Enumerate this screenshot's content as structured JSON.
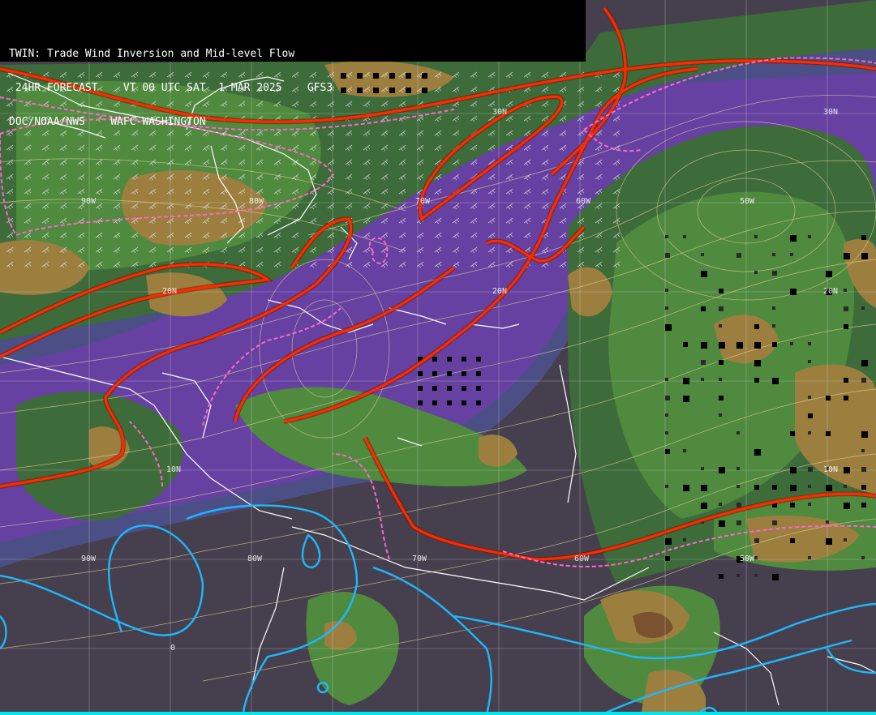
{
  "header": {
    "line1": "TWIN: Trade Wind Inversion and Mid-level Flow",
    "line2": " 24HR FORECAST    VT 00 UTC SAT  1 MAR 2025    GFS3",
    "line3": "DOC/NOAA/NWS    WAFC-WASHINGTON"
  },
  "grid_labels": {
    "lat": [
      "30N",
      "20N",
      "10N",
      "30N",
      "20N",
      "10N",
      "20N"
    ],
    "lon": [
      "90W",
      "80W",
      "70W",
      "60W",
      "50W",
      "90W",
      "80W",
      "70W",
      "60W",
      "50W",
      "0"
    ]
  },
  "colors": {
    "background": "#463f4e",
    "blue_band": "#4b4f86",
    "purple_band": "#6b3ea6",
    "green_low": "#3d6b3a",
    "green_mid": "#4f8a3e",
    "tan": "#9c7f3f",
    "brown": "#7a5230",
    "inversion_red": "#ff2a00",
    "inversion_pink": "#ff66cc",
    "cyan_contour": "#1eb8ff",
    "streamline": "#e8d79a",
    "grid": "#cfcfcf",
    "coastline": "#ffffff"
  },
  "icons": [
    "coastline-outline",
    "wind-barb",
    "streamline",
    "convection-box"
  ]
}
